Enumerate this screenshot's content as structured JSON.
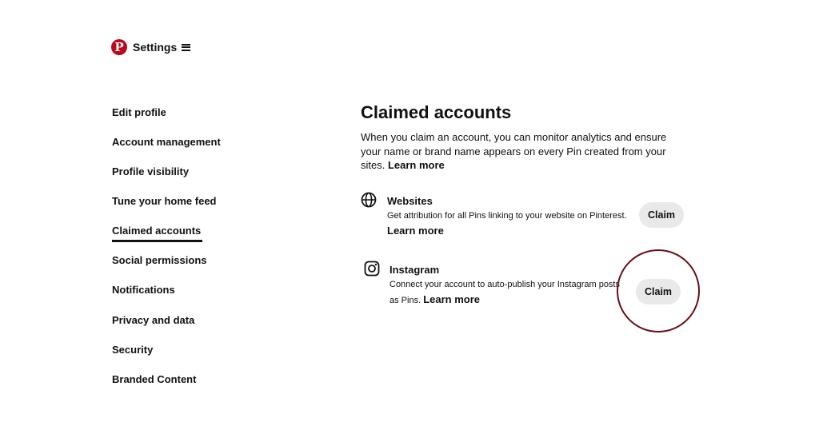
{
  "header": {
    "title": "Settings",
    "logo_icon": "pinterest-logo",
    "menu_icon": "menu-icon",
    "brand_color": "#bd081c"
  },
  "sidebar": {
    "items": [
      {
        "label": "Edit profile"
      },
      {
        "label": "Account management"
      },
      {
        "label": "Profile visibility"
      },
      {
        "label": "Tune your home feed"
      },
      {
        "label": "Claimed accounts",
        "active": true
      },
      {
        "label": "Social permissions"
      },
      {
        "label": "Notifications"
      },
      {
        "label": "Privacy and data"
      },
      {
        "label": "Security"
      },
      {
        "label": "Branded Content"
      }
    ]
  },
  "main": {
    "title": "Claimed accounts",
    "intro": "When you claim an account, you can monitor analytics and ensure your name or brand name appears on every Pin created from your sites.",
    "intro_link": "Learn more",
    "accounts": [
      {
        "icon": "globe-icon",
        "name": "Websites",
        "description": "Get attribution for all Pins linking to your website on Pinterest.",
        "link": "Learn more",
        "button": "Claim"
      },
      {
        "icon": "instagram-icon",
        "name": "Instagram",
        "description": "Connect your account to auto-publish your Instagram posts as Pins.",
        "link": "Learn more",
        "button": "Claim"
      }
    ]
  },
  "annotation": {
    "circle_color": "#6b0c14"
  }
}
